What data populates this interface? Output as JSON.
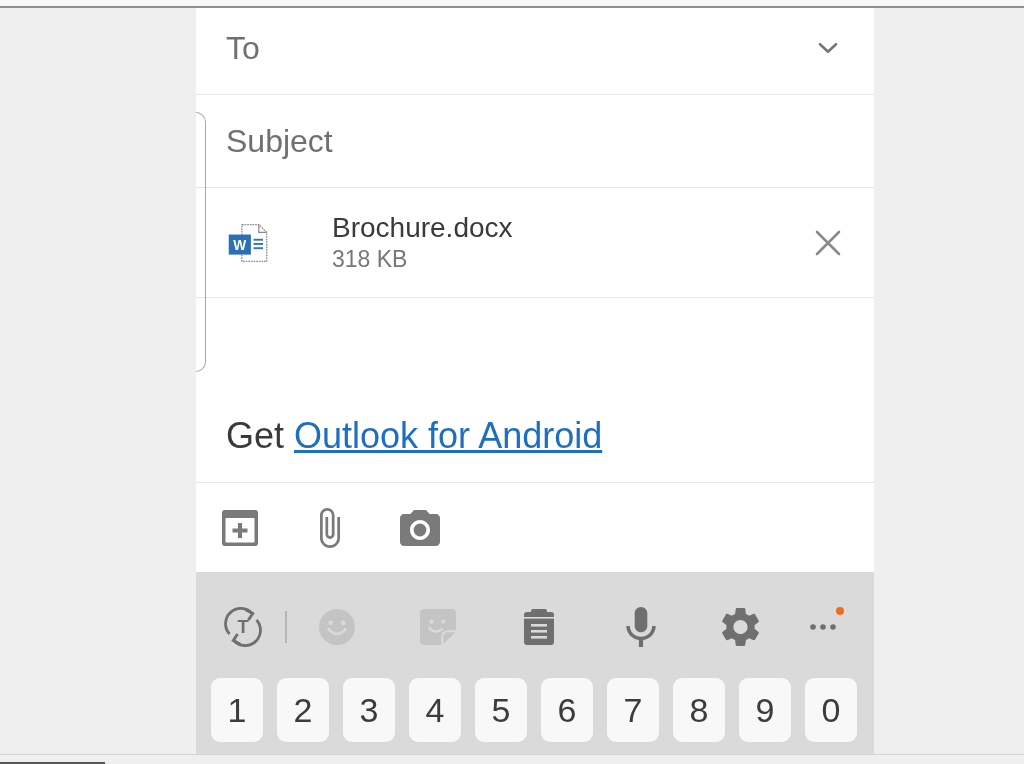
{
  "compose": {
    "to": {
      "placeholder": "To"
    },
    "subject": {
      "placeholder": "Subject"
    },
    "attachments": [
      {
        "icon_letter": "W",
        "name": "Brochure.docx",
        "size": "318 KB"
      }
    ],
    "body": {
      "signature": {
        "text": "Get",
        "link": "Outlook for Android"
      }
    },
    "actions": [
      {
        "kind": "calendar"
      },
      {
        "kind": "attach"
      },
      {
        "kind": "camera"
      }
    ]
  },
  "keyboard": {
    "toolbar": [
      {
        "kind": "translate",
        "icon_letter": "T",
        "disabled": false,
        "notification": false
      },
      {
        "kind": "emoji",
        "disabled": true,
        "notification": false
      },
      {
        "kind": "sticker",
        "disabled": true,
        "notification": false
      },
      {
        "kind": "clipboard",
        "disabled": false,
        "notification": false
      },
      {
        "kind": "voice",
        "disabled": false,
        "notification": false
      },
      {
        "kind": "settings",
        "disabled": false,
        "notification": false
      },
      {
        "kind": "more",
        "disabled": false,
        "notification": true
      }
    ],
    "keys": [
      "1",
      "2",
      "3",
      "4",
      "5",
      "6",
      "7",
      "8",
      "9",
      "0"
    ]
  }
}
